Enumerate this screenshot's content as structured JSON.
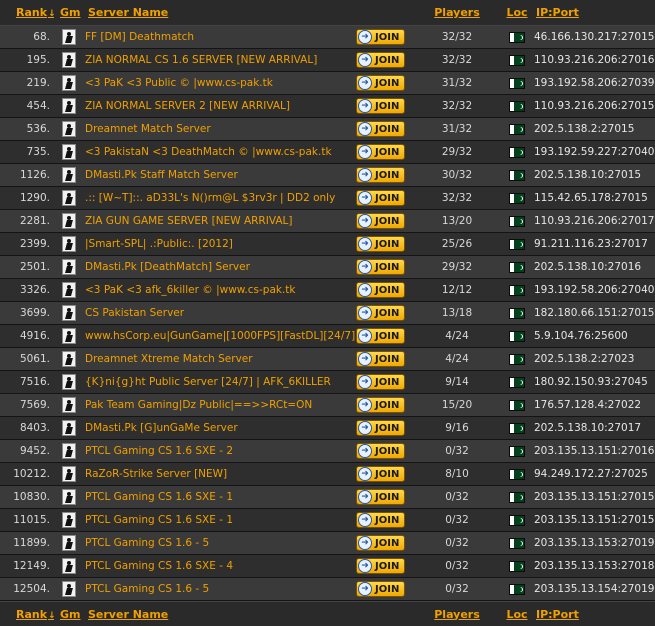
{
  "header": {
    "rank": "Rank",
    "sort_arrow": "↓",
    "gm": "Gm",
    "name": "Server Name",
    "players": "Players",
    "loc": "Loc",
    "ip": "IP:Port"
  },
  "join_label": "JOIN",
  "rows": [
    {
      "rank": "68.",
      "name": "FF [DM] Deathmatch",
      "players": "32/32",
      "ip": "46.166.130.217:27015"
    },
    {
      "rank": "195.",
      "name": "ZIA NORMAL CS 1.6 SERVER [NEW ARRIVAL]",
      "players": "32/32",
      "ip": "110.93.216.206:27016"
    },
    {
      "rank": "219.",
      "name": "<3 PaK <3 Public © |www.cs-pak.tk",
      "players": "31/32",
      "ip": "193.192.58.206:27039"
    },
    {
      "rank": "454.",
      "name": "ZIA NORMAL SERVER 2 [NEW ARRIVAL]",
      "players": "32/32",
      "ip": "110.93.216.206:27015"
    },
    {
      "rank": "536.",
      "name": "Dreamnet Match Server",
      "players": "31/32",
      "ip": "202.5.138.2:27015"
    },
    {
      "rank": "735.",
      "name": "<3 PakistaN <3 DeathMatch © |www.cs-pak.tk",
      "players": "29/32",
      "ip": "193.192.59.227:27040"
    },
    {
      "rank": "1126.",
      "name": "DMasti.Pk Staff Match Server",
      "players": "30/32",
      "ip": "202.5.138.10:27015"
    },
    {
      "rank": "1290.",
      "name": ".:: [W~T]::. aD33L's N()rm@L $3rv3r | DD2 only",
      "players": "32/32",
      "ip": "115.42.65.178:27015"
    },
    {
      "rank": "2281.",
      "name": "ZIA GUN GAME SERVER [NEW ARRIVAL]",
      "players": "13/20",
      "ip": "110.93.216.206:27017"
    },
    {
      "rank": "2399.",
      "name": "|Smart-SPL| .:Public:. [2012]",
      "players": "25/26",
      "ip": "91.211.116.23:27017"
    },
    {
      "rank": "2501.",
      "name": "DMasti.Pk [DeathMatch] Server",
      "players": "29/32",
      "ip": "202.5.138.10:27016"
    },
    {
      "rank": "3326.",
      "name": "<3 PaK <3 afk_6killer © |www.cs-pak.tk",
      "players": "12/12",
      "ip": "193.192.58.206:27040"
    },
    {
      "rank": "3699.",
      "name": "CS Pakistan Server",
      "players": "13/18",
      "ip": "182.180.66.151:27015"
    },
    {
      "rank": "4916.",
      "name": "www.hsCorp.eu|GunGame|[1000FPS][FastDL][24/7]",
      "players": "4/24",
      "ip": "5.9.104.76:25600"
    },
    {
      "rank": "5061.",
      "name": "Dreamnet Xtreme Match Server",
      "players": "4/24",
      "ip": "202.5.138.2:27023"
    },
    {
      "rank": "7516.",
      "name": "{K}ni{g}ht Public Server [24/7] | AFK_6KILLER",
      "players": "9/14",
      "ip": "180.92.150.93:27045"
    },
    {
      "rank": "7569.",
      "name": "Pak Team Gaming|Dz Public|==>>RCt=ON",
      "players": "15/20",
      "ip": "176.57.128.4:27022"
    },
    {
      "rank": "8403.",
      "name": "DMasti.Pk [G]unGaMe Server",
      "players": "9/16",
      "ip": "202.5.138.10:27017"
    },
    {
      "rank": "9452.",
      "name": "PTCL Gaming CS 1.6 SXE - 2",
      "players": "0/32",
      "ip": "203.135.13.151:27016"
    },
    {
      "rank": "10212.",
      "name": "RaZoR-Strike Server [NEW]",
      "players": "8/10",
      "ip": "94.249.172.27:27025"
    },
    {
      "rank": "10830.",
      "name": "PTCL Gaming CS 1.6 SXE - 1",
      "players": "0/32",
      "ip": "203.135.13.151:27015"
    },
    {
      "rank": "11015.",
      "name": "PTCL Gaming CS 1.6 SXE - 1",
      "players": "0/32",
      "ip": "203.135.13.151:27015"
    },
    {
      "rank": "11899.",
      "name": "PTCL Gaming CS 1.6 - 5",
      "players": "0/32",
      "ip": "203.135.13.153:27019"
    },
    {
      "rank": "12149.",
      "name": "PTCL Gaming CS 1.6 SXE - 4",
      "players": "0/32",
      "ip": "203.135.13.153:27018"
    },
    {
      "rank": "12504.",
      "name": "PTCL Gaming CS 1.6 - 5",
      "players": "0/32",
      "ip": "203.135.13.154:27019"
    }
  ],
  "icons": {
    "gm": "counter-strike-icon",
    "join": "join-icon",
    "loc": "pakistan-flag-icon"
  },
  "colors": {
    "accent": "#f0a000",
    "row_odd": "#3a3a3a",
    "row_even": "#2e2e2e"
  }
}
